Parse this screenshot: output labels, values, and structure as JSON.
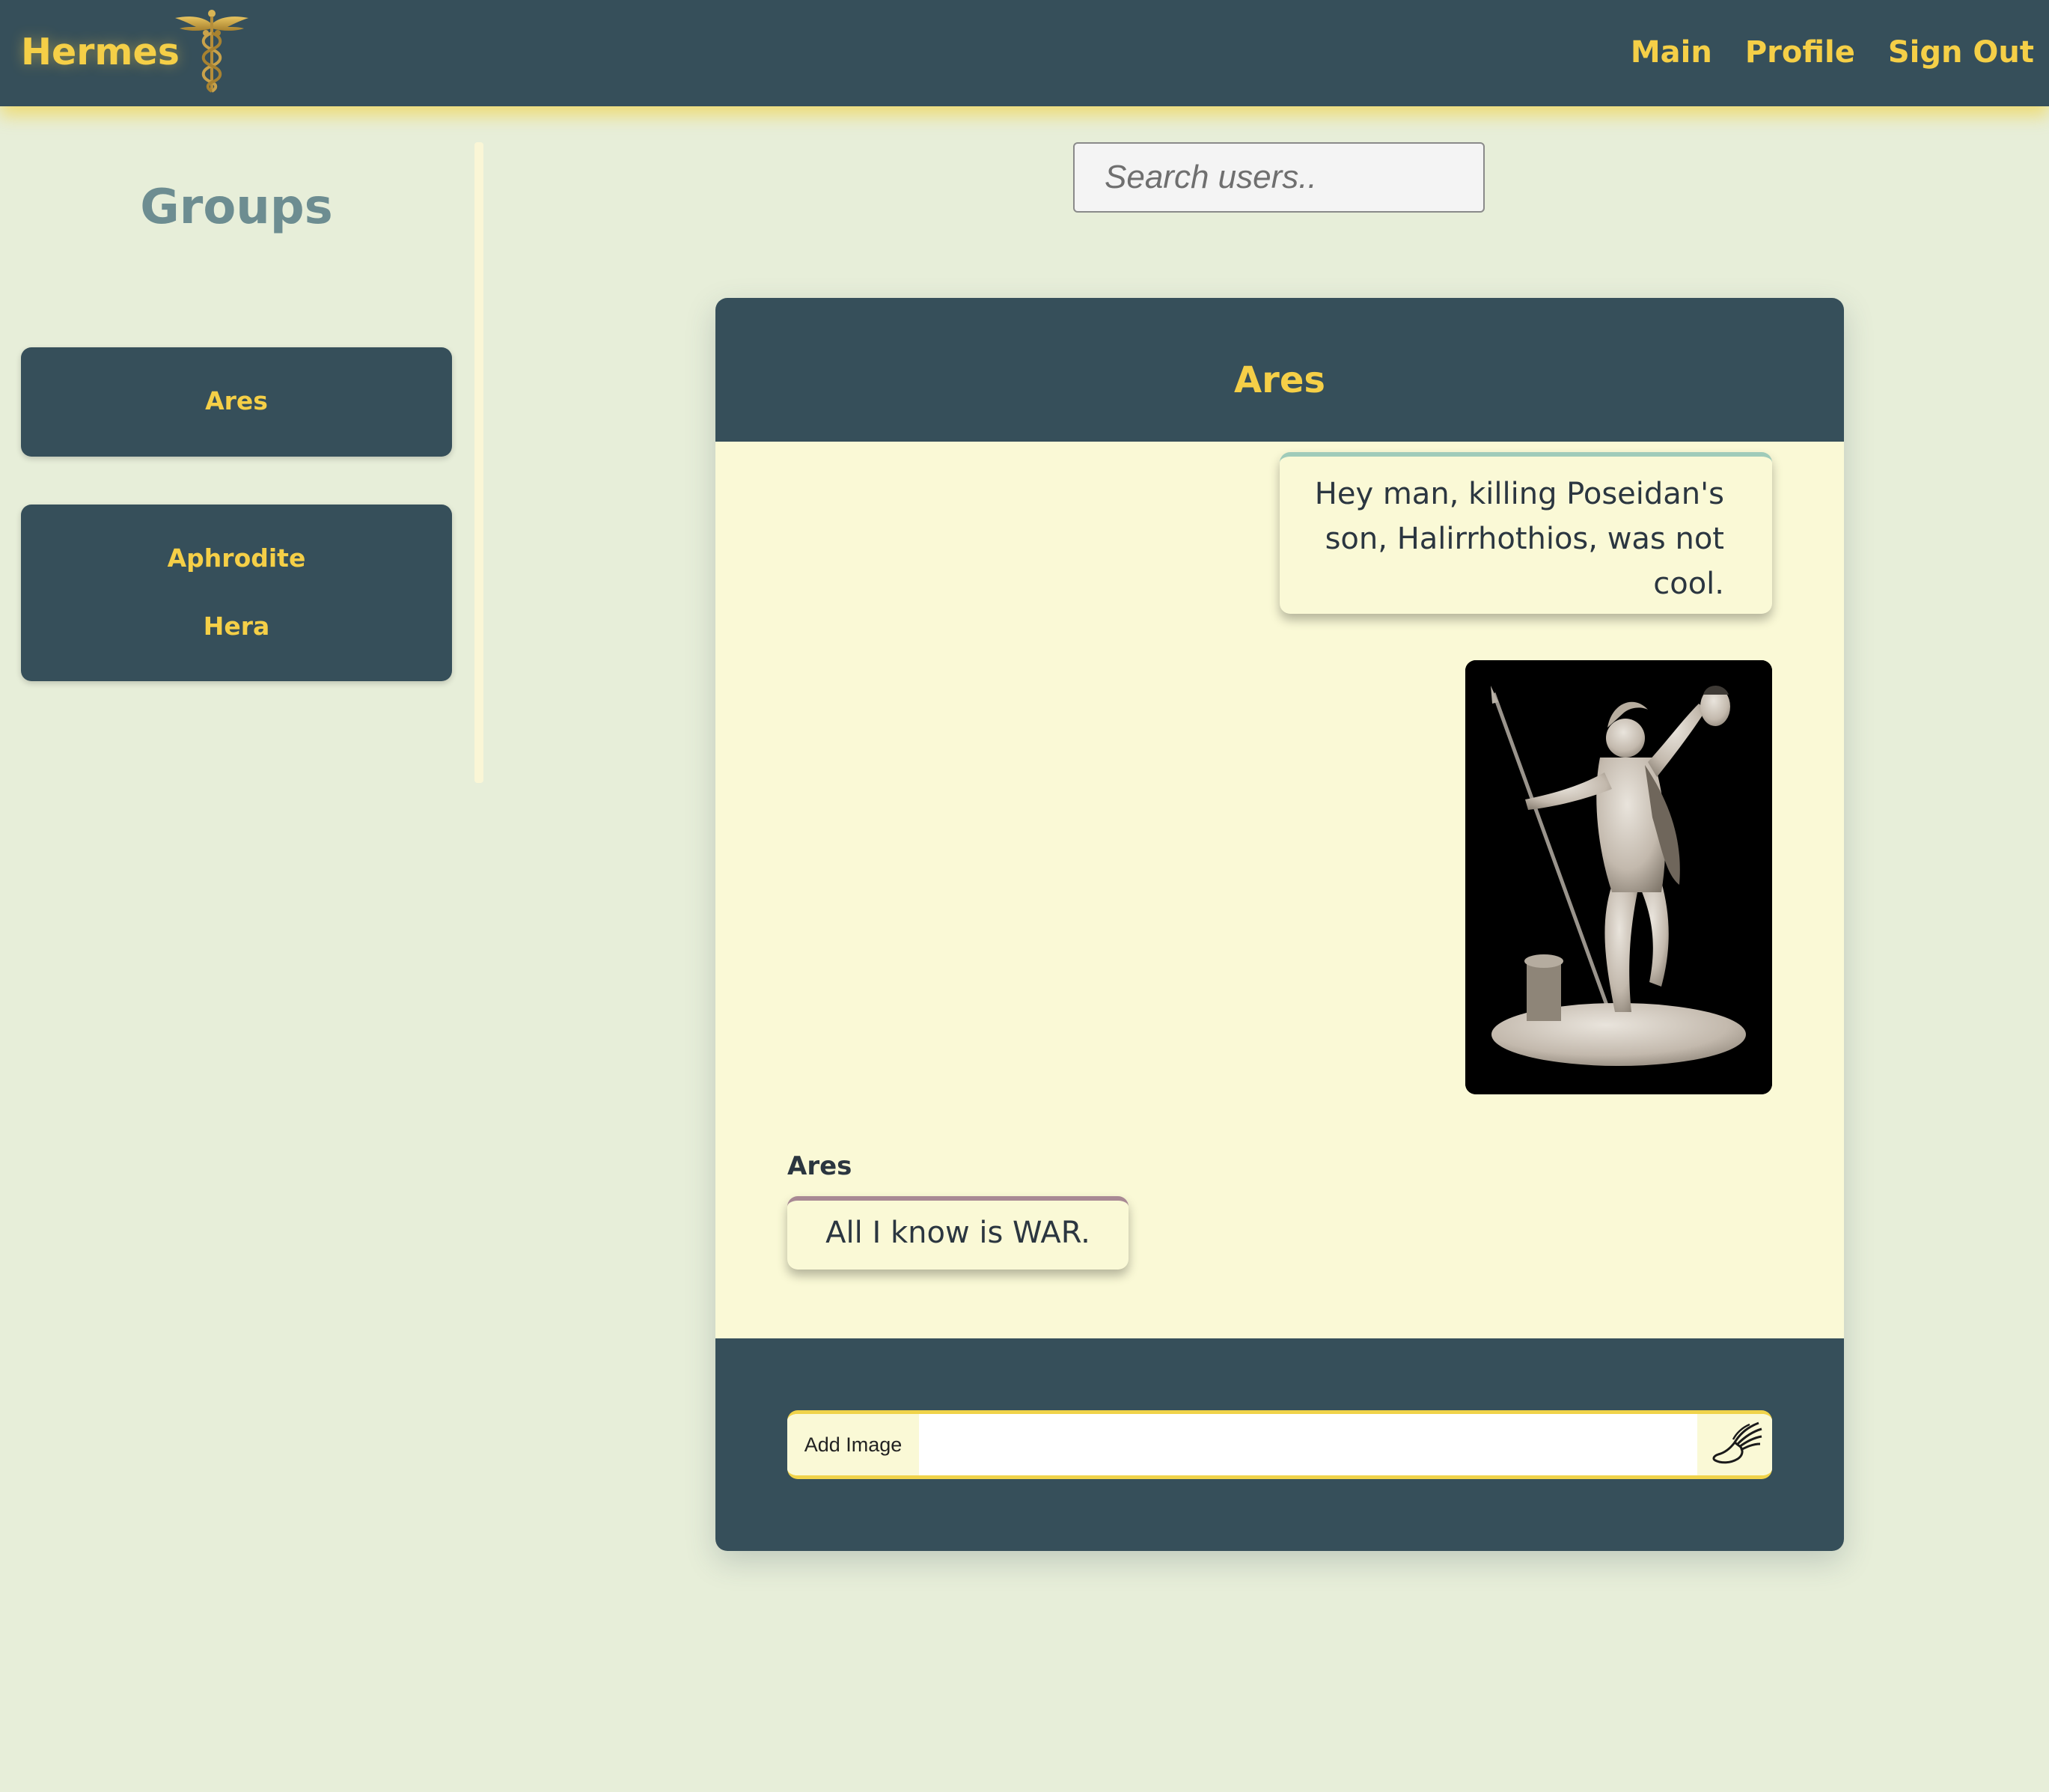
{
  "navbar": {
    "brand": "Hermes",
    "logo_icon": "caduceus-icon",
    "links": [
      {
        "label": "Main"
      },
      {
        "label": "Profile"
      },
      {
        "label": "Sign Out"
      }
    ]
  },
  "sidebar": {
    "title": "Groups",
    "groups": [
      {
        "members": [
          "Ares"
        ]
      },
      {
        "members": [
          "Aphrodite",
          "Hera"
        ]
      }
    ]
  },
  "search": {
    "placeholder": "Search users.."
  },
  "chat": {
    "title": "Ares",
    "messages": [
      {
        "direction": "sent",
        "type": "text",
        "text": "Hey man, killing Poseidan's son, Halirrhothios, was not cool."
      },
      {
        "direction": "sent",
        "type": "image",
        "image_icon": "statue-image"
      },
      {
        "direction": "received",
        "sender": "Ares",
        "type": "text",
        "text": "All I know is WAR."
      }
    ],
    "composer": {
      "add_image_label": "Add Image",
      "message_value": "",
      "send_icon": "winged-shoe-icon"
    }
  },
  "colors": {
    "navy": "#364f5a",
    "gold": "#f5cf47",
    "page_background": "#e7eed9",
    "chat_background": "#faf9d6",
    "sidebar_title": "#6d8d91",
    "sent_accent": "#9fcbb9",
    "received_accent": "#a88994"
  }
}
